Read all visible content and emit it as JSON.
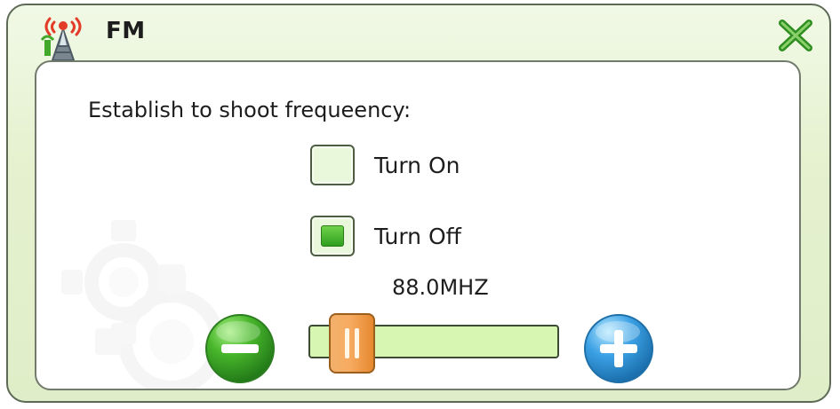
{
  "window": {
    "title": "FM",
    "app_icon": "radio-tower-icon",
    "close_icon": "close-icon"
  },
  "content": {
    "prompt": "Establish to shoot frequeency:",
    "options": [
      {
        "label": "Turn On",
        "checked": false
      },
      {
        "label": "Turn Off",
        "checked": true
      }
    ],
    "frequency": "88.0MHZ",
    "controls": {
      "minus_icon": "minus-icon",
      "plus_icon": "plus-icon",
      "slider_position": 0.1
    }
  },
  "colors": {
    "accent_green": "#36a61f",
    "accent_blue": "#2c8ed7",
    "slider_orange": "#f0a44e",
    "window_bg": "#e5f1cf"
  }
}
